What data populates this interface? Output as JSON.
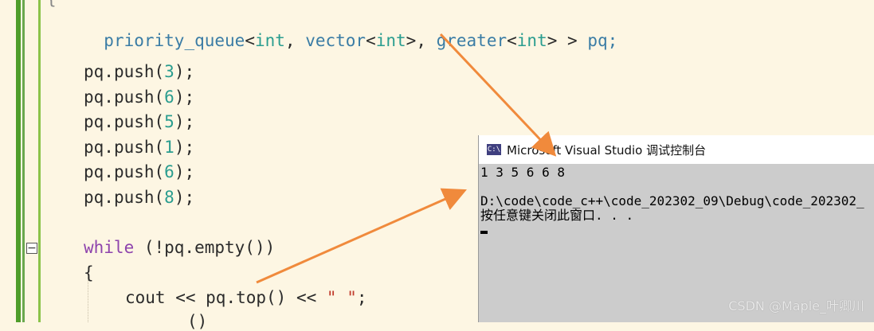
{
  "editor": {
    "lines": {
      "l1": {
        "fn": "priority_queue",
        "lt1": "<",
        "t1": "int",
        "comma1": ", ",
        "t2": "vector",
        "lt2": "<",
        "t3": "int",
        "gt2": ">",
        "comma2": ", ",
        "t4": "greater",
        "lt3": "<",
        "t5": "int",
        "gt3": ">",
        "gt1": " > ",
        "var": "pq;"
      },
      "push": [
        {
          "obj": "pq.",
          "fn": "push",
          "open": "(",
          "num": "3",
          "close": ");"
        },
        {
          "obj": "pq.",
          "fn": "push",
          "open": "(",
          "num": "6",
          "close": ");"
        },
        {
          "obj": "pq.",
          "fn": "push",
          "open": "(",
          "num": "5",
          "close": ");"
        },
        {
          "obj": "pq.",
          "fn": "push",
          "open": "(",
          "num": "1",
          "close": ");"
        },
        {
          "obj": "pq.",
          "fn": "push",
          "open": "(",
          "num": "6",
          "close": ");"
        },
        {
          "obj": "pq.",
          "fn": "push",
          "open": "(",
          "num": "8",
          "close": ");"
        }
      ],
      "while": {
        "kw": "while",
        "rest1": " (!pq.",
        "fn": "empty",
        "rest2": "())"
      },
      "brace": "{",
      "cout": {
        "id": "cout",
        "op1": " << ",
        "obj": "pq.",
        "fn": "top",
        "rest": "()",
        "op2": " << ",
        "str": "\" \"",
        "end": ";"
      },
      "partial": "()"
    },
    "fold_symbol": "−",
    "top_brace": "{"
  },
  "console": {
    "title": "Microsoft Visual Studio 调试控制台",
    "icon_label": "C:\\",
    "output": "1 3 5 6 6 8",
    "path": "D:\\code\\code_c++\\code_202302_09\\Debug\\code_202302_",
    "prompt": "按任意键关闭此窗口. . ."
  },
  "watermark": "CSDN @Maple_叶卿川",
  "colors": {
    "arrow": "#f08a3c",
    "console_bg": "#cccccc",
    "editor_bg": "#fdf6e3"
  }
}
